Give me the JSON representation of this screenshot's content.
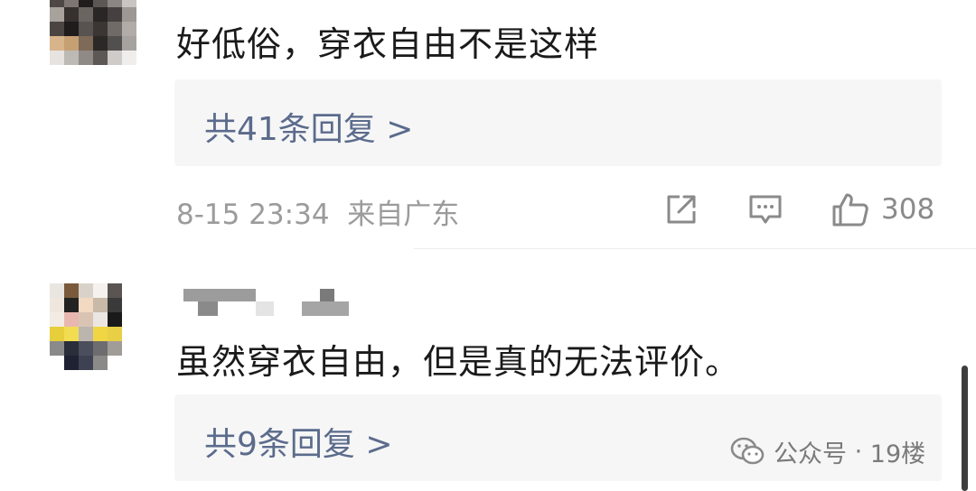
{
  "comments": [
    {
      "text": "好低俗，穿衣自由不是这样",
      "replies_label": "共41条回复 >",
      "timestamp": "8-15 23:34",
      "location": "来自广东",
      "likes": "308",
      "actions": [
        "share-icon",
        "comment-icon",
        "thumbs-up-icon"
      ]
    },
    {
      "text": "虽然穿衣自由，但是真的无法评价。",
      "replies_label": "共9条回复 >"
    }
  ],
  "watermark": {
    "source": "公众号",
    "separator": "·",
    "floor": "19楼"
  },
  "colors": {
    "reply_link": "#5b6b8c",
    "reply_bg": "#f6f6f6",
    "meta_text": "#9b9b9b",
    "body_text": "#1a1a1a"
  }
}
